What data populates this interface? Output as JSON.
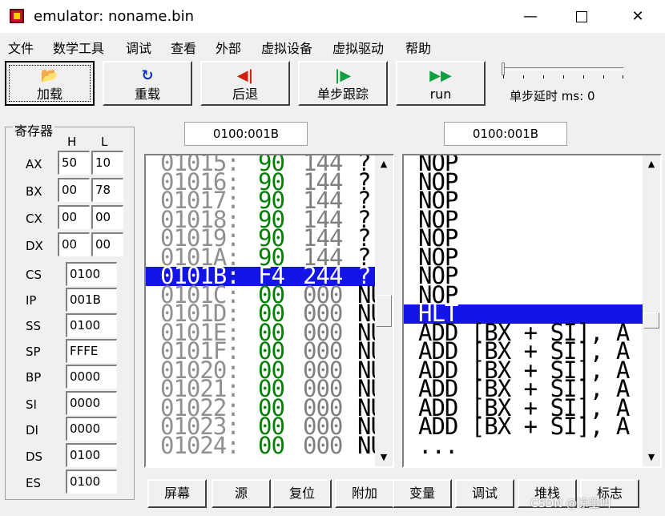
{
  "window": {
    "title": "emulator: noname.bin",
    "min": "—",
    "close": "✕"
  },
  "menu": [
    "文件",
    "数学工具",
    "调试",
    "查看",
    "外部",
    "虚拟设备",
    "虚拟驱动",
    "帮助"
  ],
  "toolbar": [
    {
      "label": "加载",
      "icon": "folder-open-icon",
      "glyph": "📂",
      "color": "#c08000"
    },
    {
      "label": "重载",
      "icon": "reload-icon",
      "glyph": "↻",
      "color": "#1030c0"
    },
    {
      "label": "后退",
      "icon": "step-back-icon",
      "glyph": "◀|",
      "color": "#d02010"
    },
    {
      "label": "单步跟踪",
      "icon": "step-icon",
      "glyph": "|▶",
      "color": "#10a040"
    },
    {
      "label": "run",
      "icon": "run-icon",
      "glyph": "▶▶",
      "color": "#10a040"
    }
  ],
  "delay": {
    "label": "单步延时 ms: 0",
    "value": 0
  },
  "registers": {
    "title": "寄存器",
    "h_label": "H",
    "l_label": "L",
    "general": [
      {
        "name": "AX",
        "h": "50",
        "l": "10"
      },
      {
        "name": "BX",
        "h": "00",
        "l": "78"
      },
      {
        "name": "CX",
        "h": "00",
        "l": "00"
      },
      {
        "name": "DX",
        "h": "00",
        "l": "00"
      }
    ],
    "segment": [
      {
        "name": "CS",
        "value": "0100"
      },
      {
        "name": "IP",
        "value": "001B"
      },
      {
        "name": "SS",
        "value": "0100"
      },
      {
        "name": "SP",
        "value": "FFFE"
      },
      {
        "name": "BP",
        "value": "0000"
      },
      {
        "name": "SI",
        "value": "0000"
      },
      {
        "name": "DI",
        "value": "0000"
      },
      {
        "name": "DS",
        "value": "0100"
      },
      {
        "name": "ES",
        "value": "0100"
      }
    ]
  },
  "memory": {
    "address": "0100:001B",
    "rows": [
      {
        "addr": "01015:",
        "hex": "90",
        "dec": "144",
        "chr": "?"
      },
      {
        "addr": "01016:",
        "hex": "90",
        "dec": "144",
        "chr": "?"
      },
      {
        "addr": "01017:",
        "hex": "90",
        "dec": "144",
        "chr": "?"
      },
      {
        "addr": "01018:",
        "hex": "90",
        "dec": "144",
        "chr": "?"
      },
      {
        "addr": "01019:",
        "hex": "90",
        "dec": "144",
        "chr": "?"
      },
      {
        "addr": "0101A:",
        "hex": "90",
        "dec": "144",
        "chr": "?"
      },
      {
        "addr": "0101B:",
        "hex": "F4",
        "dec": "244",
        "chr": "?",
        "selected": true
      },
      {
        "addr": "0101C:",
        "hex": "00",
        "dec": "000",
        "chr": "NU"
      },
      {
        "addr": "0101D:",
        "hex": "00",
        "dec": "000",
        "chr": "NU"
      },
      {
        "addr": "0101E:",
        "hex": "00",
        "dec": "000",
        "chr": "NU"
      },
      {
        "addr": "0101F:",
        "hex": "00",
        "dec": "000",
        "chr": "NU"
      },
      {
        "addr": "01020:",
        "hex": "00",
        "dec": "000",
        "chr": "NU"
      },
      {
        "addr": "01021:",
        "hex": "00",
        "dec": "000",
        "chr": "NU"
      },
      {
        "addr": "01022:",
        "hex": "00",
        "dec": "000",
        "chr": "NU"
      },
      {
        "addr": "01023:",
        "hex": "00",
        "dec": "000",
        "chr": "NU"
      },
      {
        "addr": "01024:",
        "hex": "00",
        "dec": "000",
        "chr": "NU"
      }
    ]
  },
  "disasm": {
    "address": "0100:001B",
    "rows": [
      {
        "text": "NOP"
      },
      {
        "text": "NOP"
      },
      {
        "text": "NOP"
      },
      {
        "text": "NOP"
      },
      {
        "text": "NOP"
      },
      {
        "text": "NOP"
      },
      {
        "text": "NOP"
      },
      {
        "text": "NOP"
      },
      {
        "text": "HLT",
        "selected": true
      },
      {
        "text": "ADD [BX + SI], A"
      },
      {
        "text": "ADD [BX + SI], A"
      },
      {
        "text": "ADD [BX + SI], A"
      },
      {
        "text": "ADD [BX + SI], A"
      },
      {
        "text": "ADD [BX + SI], A"
      },
      {
        "text": "ADD [BX + SI], A"
      },
      {
        "text": "..."
      }
    ]
  },
  "bottom_buttons": [
    "屏幕",
    "源",
    "复位",
    "附加",
    "变量",
    "调试",
    "堆栈",
    "标志"
  ],
  "watermark": "CSDN @凉墨叫"
}
